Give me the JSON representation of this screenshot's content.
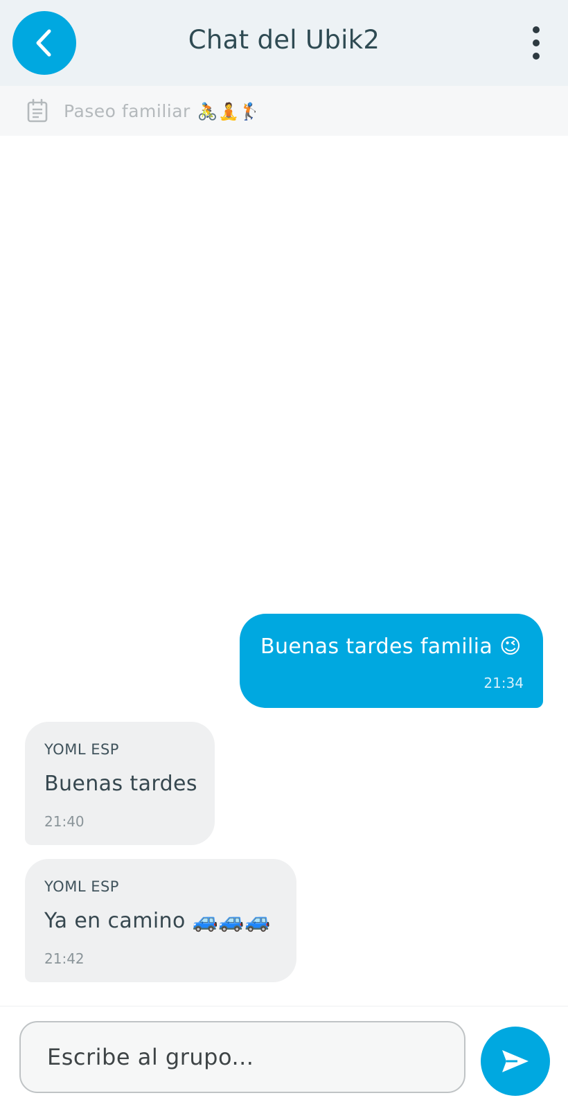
{
  "header": {
    "title": "Chat del Ubik2",
    "back_icon": "chevron-left-icon",
    "menu_icon": "more-vertical-icon"
  },
  "subbar": {
    "icon": "calendar-icon",
    "label": "Paseo familiar",
    "emojis": "🚴🧘🏌"
  },
  "messages": [
    {
      "direction": "outgoing",
      "text": "Buenas tardes familia 😉",
      "time": "21:34"
    },
    {
      "direction": "incoming",
      "sender": "YOML ESP",
      "text": "Buenas tardes",
      "time": "21:40"
    },
    {
      "direction": "incoming",
      "sender": "YOML ESP",
      "text": "Ya en camino 🚙🚙🚙",
      "time": "21:42"
    }
  ],
  "composer": {
    "placeholder": "Escribe al grupo...",
    "send_icon": "send-icon"
  },
  "colors": {
    "accent": "#00a8e0",
    "header_bg": "#edf2f5",
    "incoming_bubble": "#eff0f1"
  }
}
